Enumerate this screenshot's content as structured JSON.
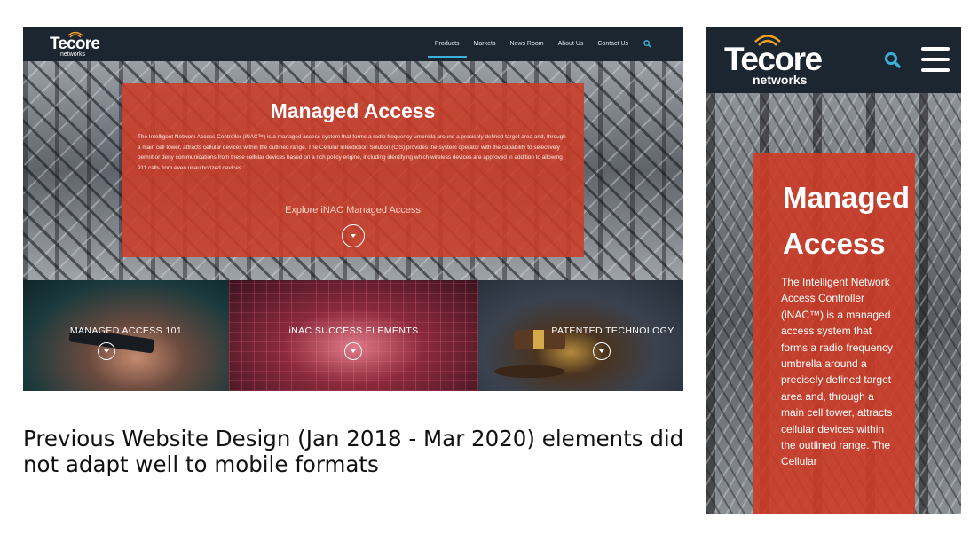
{
  "desktop": {
    "nav": {
      "logo_word": "Tecore",
      "logo_sub": "networks",
      "items": [
        {
          "label": "Products",
          "active": true
        },
        {
          "label": "Markets",
          "active": false
        },
        {
          "label": "News Room",
          "active": false
        },
        {
          "label": "About Us",
          "active": false
        },
        {
          "label": "Contact Us",
          "active": false
        }
      ],
      "search_icon": "search-icon"
    },
    "hero": {
      "title": "Managed Access",
      "body": "The Intelligent Network Access Controller (iNAC™) is a managed access system that forms a radio frequency umbrella around a precisely defined target area and, through a main cell tower, attracts cellular devices within the outlined range. The Cellular Interdiction Solution (CIS) provides the system operator with the capability to selectively permit or deny communications from these cellular devices based on a rich policy engine, including identifying which wireless devices are approved in addition to allowing 911 calls from even unauthorized devices.",
      "link": "Explore iNAC Managed Access"
    },
    "tiles": [
      {
        "label": "MANAGED ACCESS 101"
      },
      {
        "label": "iNAC SUCCESS ELEMENTS"
      },
      {
        "label": "PATENTED TECHNOLOGY"
      }
    ]
  },
  "caption": "Previous Website Design (Jan 2018 - Mar 2020) elements did not adapt well to mobile formats",
  "mobile": {
    "nav": {
      "logo_word": "Tecore",
      "logo_sub": "networks",
      "search_icon": "search-icon",
      "menu_icon": "hamburger-menu-icon"
    },
    "hero": {
      "title": "Managed Access",
      "body": "The Intelligent Network Access Controller (iNAC™) is a managed access system that forms a radio frequency umbrella around a precisely defined target area and, through a main cell tower, attracts cellular devices within the outlined range. The Cellular"
    }
  },
  "colors": {
    "nav_bg": "#1c2631",
    "accent": "#3bb1d9",
    "logo_arc": "#f0a21e",
    "hero_overlay": "#cd3c28"
  }
}
